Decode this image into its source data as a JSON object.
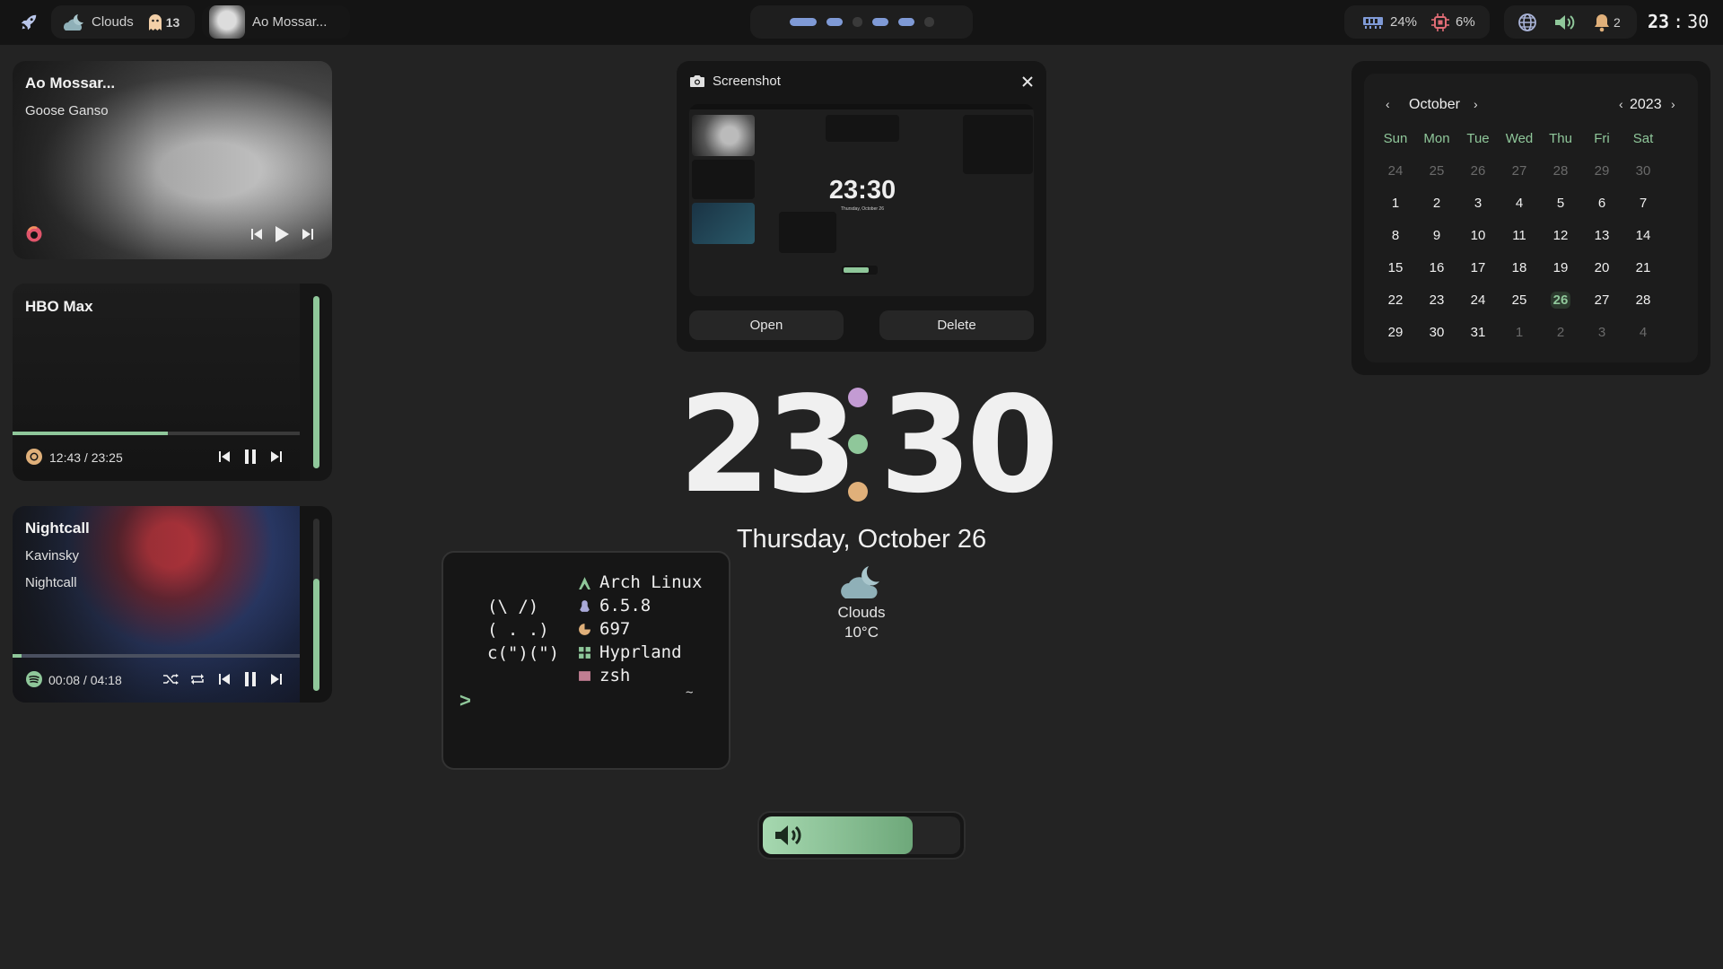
{
  "topbar": {
    "launcher_icon": "rocket-icon",
    "weather_label": "Clouds",
    "ghost_count": "13",
    "now_playing": "Ao Mossar...",
    "workspaces": [
      {
        "id": 1,
        "active": true,
        "wide": true
      },
      {
        "id": 2,
        "active": true,
        "wide": false
      },
      {
        "id": 3,
        "active": false,
        "wide": false
      },
      {
        "id": 4,
        "active": true,
        "wide": false
      },
      {
        "id": 5,
        "active": true,
        "wide": false
      },
      {
        "id": 6,
        "active": false,
        "wide": false
      }
    ],
    "ram": "24%",
    "cpu": "6%",
    "notifications": "2",
    "clock_hours": "23",
    "clock_sep": ":",
    "clock_minutes": "30"
  },
  "players": [
    {
      "title": "Ao Mossar...",
      "artist": "Goose Ganso",
      "source_icon": "firefox-icon",
      "state": "paused"
    },
    {
      "title": "HBO Max",
      "time": "12:43 / 23:25",
      "progress": 0.54,
      "source_icon": "chrome-icon",
      "state": "playing",
      "volume": 1.0
    },
    {
      "title": "Nightcall",
      "artist": "Kavinsky",
      "album": "Nightcall",
      "time": "00:08 / 04:18",
      "progress": 0.03,
      "source_icon": "spotify-icon",
      "state": "playing",
      "volume": 0.65
    }
  ],
  "screenshot": {
    "title": "Screenshot",
    "open_label": "Open",
    "delete_label": "Delete",
    "preview_clock": "23:30",
    "preview_date": "Thursday, October 26"
  },
  "clock": {
    "hours": "23",
    "minutes": "30",
    "date": "Thursday, October 26",
    "weather_condition": "Clouds",
    "temperature": "10°C",
    "dot_colors": [
      "#c39bd3",
      "#8fc79a",
      "#e0b07a"
    ]
  },
  "calendar": {
    "month": "October",
    "year": "2023",
    "weekdays": [
      "Sun",
      "Mon",
      "Tue",
      "Wed",
      "Thu",
      "Fri",
      "Sat"
    ],
    "weeks": [
      [
        "24",
        "25",
        "26",
        "27",
        "28",
        "29",
        "30"
      ],
      [
        "1",
        "2",
        "3",
        "4",
        "5",
        "6",
        "7"
      ],
      [
        "8",
        "9",
        "10",
        "11",
        "12",
        "13",
        "14"
      ],
      [
        "15",
        "16",
        "17",
        "18",
        "19",
        "20",
        "21"
      ],
      [
        "22",
        "23",
        "24",
        "25",
        "26",
        "27",
        "28"
      ],
      [
        "29",
        "30",
        "31",
        "1",
        "2",
        "3",
        "4"
      ]
    ],
    "today": "26",
    "accent": "#8fc79a"
  },
  "fetch": {
    "art": [
      "(\\ /)",
      "( . .)",
      "c(\")(\")"
    ],
    "items": [
      {
        "icon": "arch-icon",
        "text": "Arch Linux",
        "color": "#8fc79a"
      },
      {
        "icon": "linux-icon",
        "text": "6.5.8",
        "color": "#a9a9d8"
      },
      {
        "icon": "package-icon",
        "text": "697",
        "color": "#e0b07a"
      },
      {
        "icon": "grid-icon",
        "text": "Hyprland",
        "color": "#8fc79a"
      },
      {
        "icon": "terminal-icon",
        "text": "zsh",
        "color": "#d48aa0"
      }
    ],
    "prompt": ">",
    "cwd": "~"
  },
  "volume_osd": {
    "level": 0.76,
    "icon": "speaker-icon"
  }
}
